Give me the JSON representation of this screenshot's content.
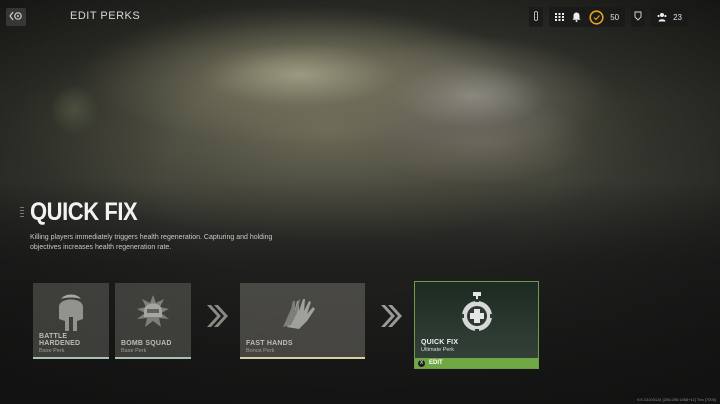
{
  "header": {
    "title": "EDIT PERKS",
    "icons": [
      "back-icon",
      "mic-icon",
      "grid-menu-icon",
      "bell-icon",
      "rank-ring-icon",
      "battlepass-icon",
      "friends-icon"
    ],
    "level": "50",
    "friends_count": "23"
  },
  "perk": {
    "title": "QUICK FIX",
    "description": "Killing players immediately triggers health regeneration. Capturing and holding objectives increases health regeneration rate."
  },
  "cards": [
    {
      "name": "BATTLE HARDENED",
      "type": "Base Perk",
      "icon": "spartan-helmet-icon"
    },
    {
      "name": "BOMB SQUAD",
      "type": "Base Perk",
      "icon": "bomb-squad-helmet-icon"
    },
    {
      "name": "FAST HANDS",
      "type": "Bonus Perk",
      "icon": "hands-icon"
    },
    {
      "name": "QUICK FIX",
      "type": "Ultimate Perk",
      "icon": "medic-cross-gear-icon",
      "action": "EDIT",
      "action_button": "X"
    }
  ],
  "version_text": "9.5.13100124 [255:255:1468+11] Tnn [7000]",
  "colors": {
    "accent_green": "#6fa845",
    "selected_border": "#6f9a4a"
  }
}
